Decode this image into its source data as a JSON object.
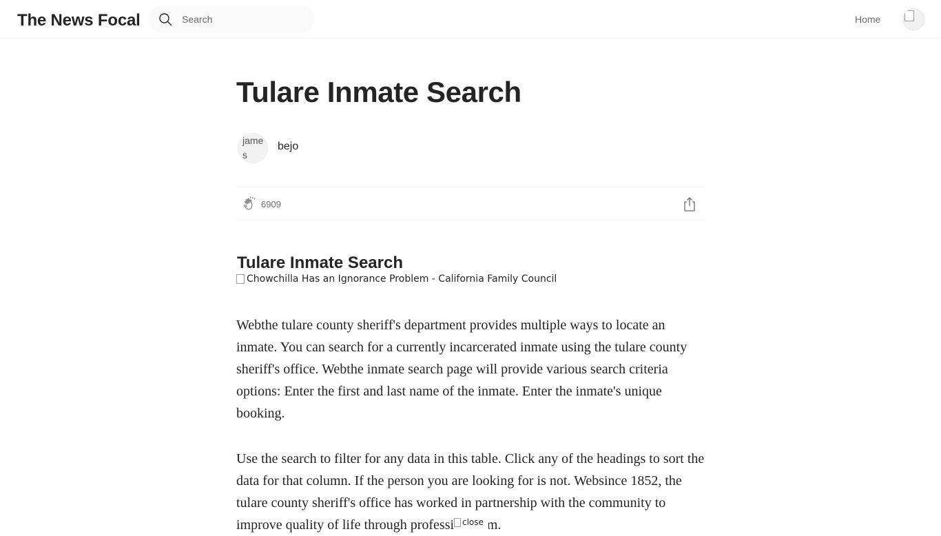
{
  "header": {
    "brand": "The News Focal",
    "search_placeholder": "Search",
    "nav_home": "Home",
    "icons": {
      "search": "search-icon",
      "avatar": "user-avatar"
    }
  },
  "article": {
    "title": "Tulare Inmate Search",
    "author": {
      "avatar_alt": "james",
      "name": "bejo"
    },
    "claps": "6909",
    "icons": {
      "clap": "clap-icon",
      "share": "share-icon"
    },
    "section_heading": "Tulare Inmate Search",
    "image_alt": "Chowchilla Has an Ignorance Problem - California Family Council",
    "paragraphs": [
      "Webthe tulare county sheriff's department provides multiple ways to locate an inmate. You can search for a currently incarcerated inmate using the tulare county sheriff's office. Webthe inmate search page will provide various search criteria options: Enter the first and last name of the inmate. Enter the inmate's unique booking.",
      "Use the search to filter for any data in this table. Click any of the headings to sort the data for that column. If the person you are looking for is not. Websince 1852, the tulare county sheriff's office has worked in partnership with the community to improve quality of life through professionalism."
    ],
    "overlay_close_alt": "close"
  }
}
